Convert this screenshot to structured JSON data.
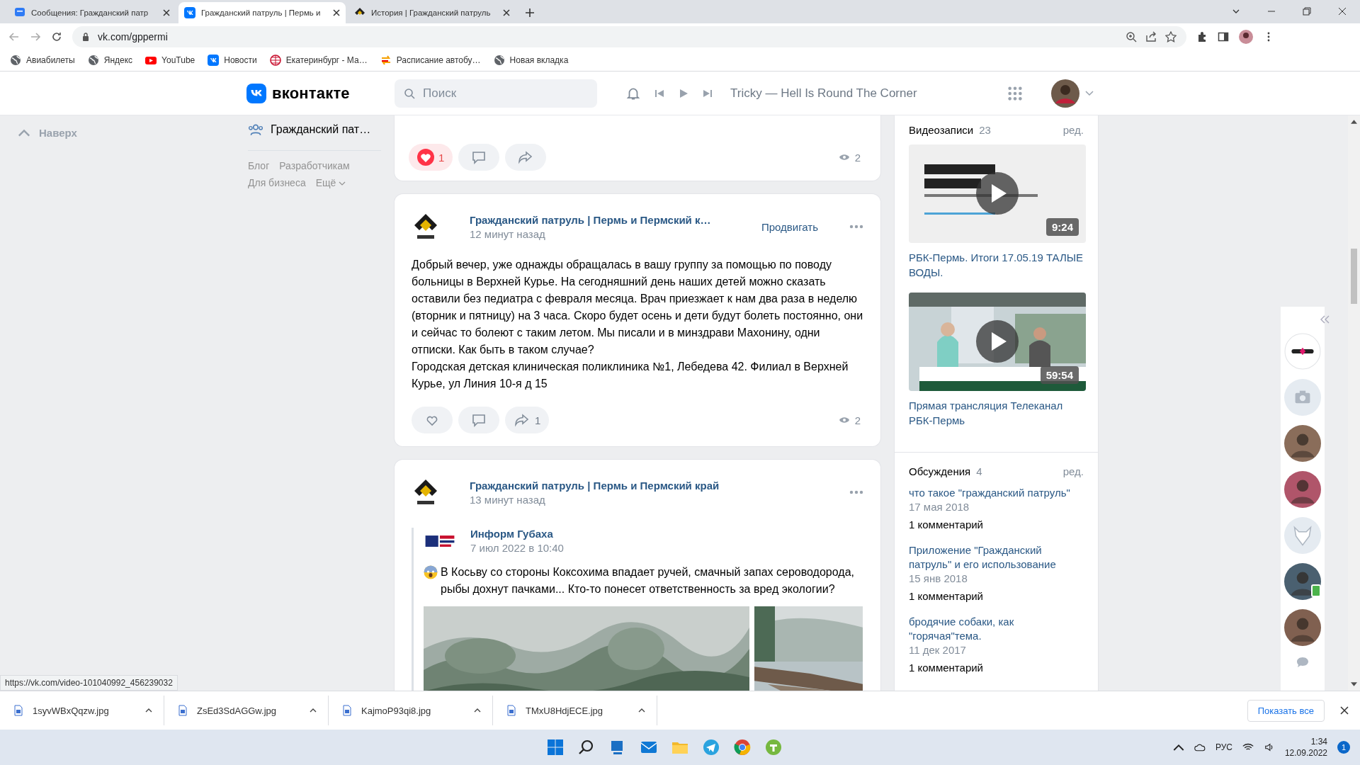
{
  "browser": {
    "tabs": [
      {
        "kind": "chat",
        "title": "Сообщения: Гражданский патр",
        "selected": false
      },
      {
        "kind": "vk",
        "title": "Гражданский патруль | Пермь и",
        "selected": true
      },
      {
        "kind": "logo",
        "title": "История | Гражданский патруль",
        "selected": false
      }
    ],
    "address": "vk.com/gppermi",
    "bookmarks": [
      {
        "kind": "globe",
        "label": "Авиабилеты"
      },
      {
        "kind": "globe",
        "label": "Яндекс"
      },
      {
        "kind": "youtube",
        "label": "YouTube"
      },
      {
        "kind": "vk",
        "label": "Новости"
      },
      {
        "kind": "ufs",
        "label": "Екатеринбург - Ма…"
      },
      {
        "kind": "bus",
        "label": "Расписание автобу…"
      },
      {
        "kind": "globe",
        "label": "Новая вкладка"
      }
    ]
  },
  "header": {
    "logo": "вконтакте",
    "search_placeholder": "Поиск",
    "track": "Tricky — Hell Is Round The Corner"
  },
  "left": {
    "back_to_top": "Наверх",
    "group_link": "Гражданский пат…",
    "footer_links": [
      "Блог",
      "Разработчикам",
      "Для бизнеса",
      "Ещё"
    ]
  },
  "feed": [
    {
      "kind": "partial",
      "liked": true,
      "likes": "1",
      "views": "2"
    },
    {
      "kind": "post",
      "author": "Гражданский патруль | Пермь и Пермский к…",
      "time": "12 минут назад",
      "promote": "Продвигать",
      "text": "Добрый вечер, уже однажды обращалась в вашу группу за помощью по поводу больницы в Верхней Курье. На сегодняшний день наших детей можно сказать оставили без педиатра с февраля месяца. Врач приезжает к нам два раза в неделю (вторник и пятницу) на 3 часа. Скоро будет осень и дети будут болеть постоянно, они и сейчас то болеют с таким летом. Мы писали и в минздрави Махонину, одни отписки. Как быть в таком случае?\nГородская детская клиническая поликлиника №1, Лебедева 42. Филиал в Верхней Курье, ул Линия 10-я д 15",
      "liked": false,
      "shares": "1",
      "views": "2"
    },
    {
      "kind": "repost",
      "author": "Гражданский патруль | Пермь и Пермский край",
      "time": "13 минут назад",
      "repost": {
        "author": "Информ Губаха",
        "time": "7 июл 2022 в 10:40",
        "text": "В Косьву со стороны Коксохима впадает ручей, смачный запах сероводорода, рыбы дохнут пачками... Кто-то понесет ответственность за вред экологии?"
      }
    }
  ],
  "videos": {
    "title": "Видеозаписи",
    "count": "23",
    "edit": "ред.",
    "items": [
      {
        "duration": "9:24",
        "title": "РБК-Пермь. Итоги 17.05.19 ТАЛЫЕ ВОДЫ."
      },
      {
        "duration": "59:54",
        "title": "Прямая трансляция Телеканал РБК-Пермь"
      }
    ]
  },
  "discussions": {
    "title": "Обсуждения",
    "count": "4",
    "edit": "ред.",
    "items": [
      {
        "title": "что такое \"гражданский патруль\"",
        "date": "17 мая 2018",
        "comments": "1 комментарий"
      },
      {
        "title": "Приложение \"Гражданский патруль\" и его использование",
        "date": "15 янв 2018",
        "comments": "1 комментарий"
      },
      {
        "title": "бродячие собаки, как \"горячая\"тема.",
        "date": "11 дек 2017",
        "comments": "1 комментарий"
      }
    ]
  },
  "friends": [
    {
      "kind": "logo",
      "online": false
    },
    {
      "kind": "camera",
      "online": false
    },
    {
      "kind": "avatar",
      "online": false
    },
    {
      "kind": "avatar",
      "online": false
    },
    {
      "kind": "dog",
      "online": false
    },
    {
      "kind": "avatar",
      "online": true
    },
    {
      "kind": "avatar",
      "online": false
    }
  ],
  "status_url": "https://vk.com/video-101040992_456239032",
  "downloads": {
    "files": [
      "1syvWBxQqzw.jpg",
      "ZsEd3SdAGGw.jpg",
      "KajmoP93qi8.jpg",
      "TMxU8HdjECE.jpg"
    ],
    "show_all": "Показать все"
  },
  "taskbar": {
    "language": "РУС",
    "time": "1:34",
    "date": "12.09.2022",
    "notifications": "1"
  }
}
